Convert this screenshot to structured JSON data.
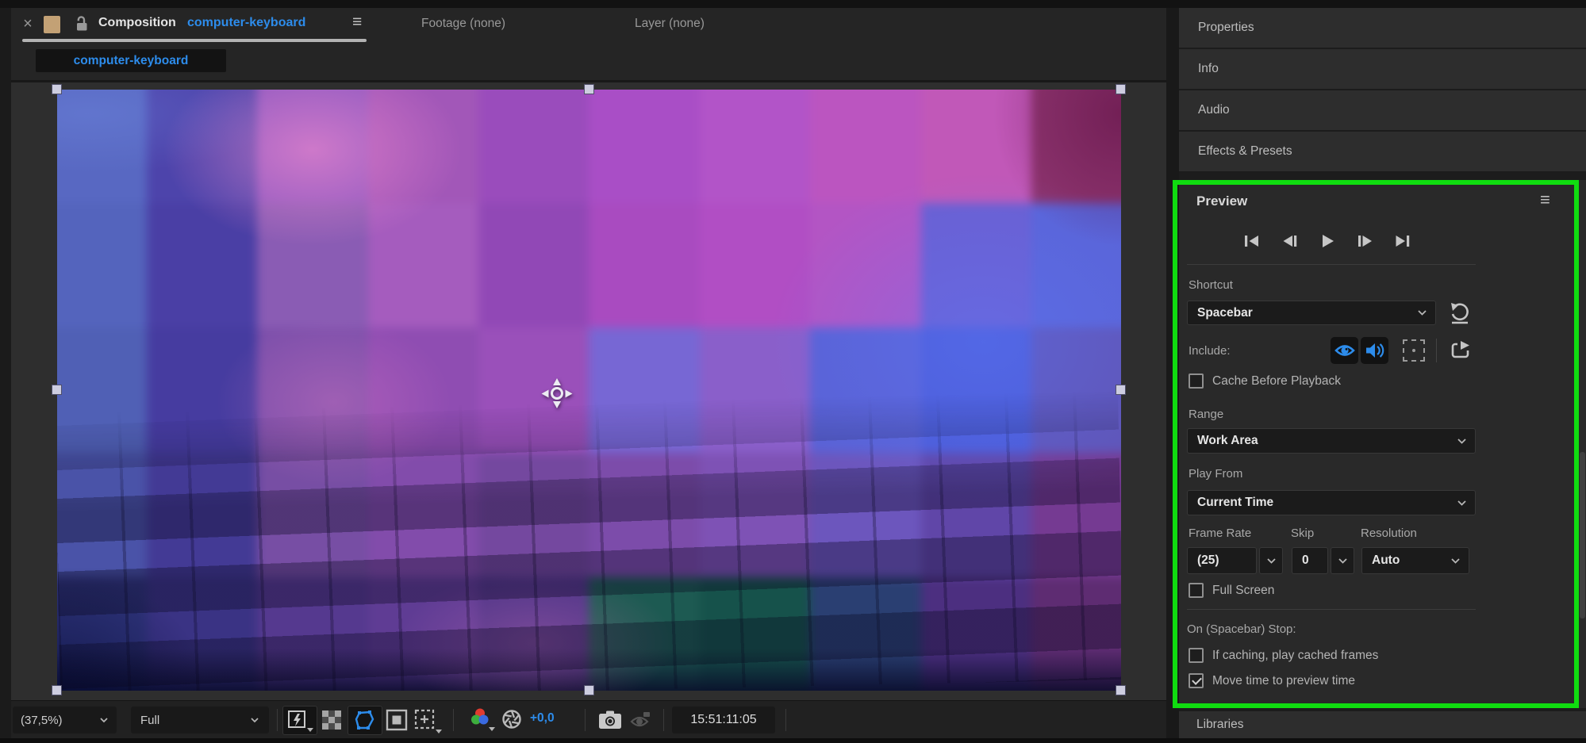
{
  "colors": {
    "accent_blue": "#2d8ceb",
    "highlight_green": "#10dc10",
    "swatch_tan": "#c3a175"
  },
  "icons": {
    "close_glyph": "×",
    "menu_glyph": "≡"
  },
  "comp_panel": {
    "composition_label": "Composition",
    "composition_name": "computer-keyboard",
    "footage_tab": "Footage (none)",
    "layer_tab": "Layer (none)",
    "viewer_tab": "computer-keyboard"
  },
  "toolbar": {
    "zoom_value": "(37,5%)",
    "resolution_value": "Full",
    "exposure_value": "+0,0",
    "timecode": "15:51:11:05"
  },
  "right_panel": {
    "tabs": [
      "Properties",
      "Info",
      "Audio",
      "Effects & Presets"
    ],
    "libraries_tab": "Libraries",
    "preview": {
      "title": "Preview",
      "shortcut_label": "Shortcut",
      "shortcut_value": "Spacebar",
      "include_label": "Include:",
      "cache_label": "Cache Before Playback",
      "range_label": "Range",
      "range_value": "Work Area",
      "playfrom_label": "Play From",
      "playfrom_value": "Current Time",
      "framerate_label": "Frame Rate",
      "framerate_value": "(25)",
      "skip_label": "Skip",
      "skip_value": "0",
      "resolution_label": "Resolution",
      "resolution_value": "Auto",
      "fullscreen_label": "Full Screen",
      "onstop_label": "On (Spacebar) Stop:",
      "stop_option_1": "If caching, play cached frames",
      "stop_option_2": "Move time to preview time"
    }
  },
  "viewport": {
    "mosaic": {
      "cols": 10,
      "rows": 5,
      "cells": [
        "#5868c2",
        "#4d44ab",
        "#8e58c0",
        "#a257b8",
        "#9a4cbc",
        "#a94ec6",
        "#b254c8",
        "#bb55c0",
        "#c158b8",
        "#8e3570",
        "#5464bd",
        "#4a3fa5",
        "#8a5cb4",
        "#a55cbe",
        "#9148b6",
        "#a94bc0",
        "#b14ec4",
        "#b355c4",
        "#6a5fd2",
        "#5a64d8",
        "#5060b5",
        "#463ca0",
        "#7e50ab",
        "#8f4db2",
        "#9a50ba",
        "#7767d4",
        "#8a5fca",
        "#5a62d6",
        "#4c5cd8",
        "#5f55b8",
        "#4a53a8",
        "#433a95",
        "#774ea4",
        "#824cab",
        "#74489f",
        "#7c4caa",
        "#7e52b5",
        "#6c56bd",
        "#6046a8",
        "#753a92",
        "#2e3379",
        "#3a3384",
        "#55398f",
        "#5f3c94",
        "#4f3588",
        "#1d5a52",
        "#16524b",
        "#2a3f72",
        "#4c2f80",
        "#5e2c72"
      ]
    }
  }
}
